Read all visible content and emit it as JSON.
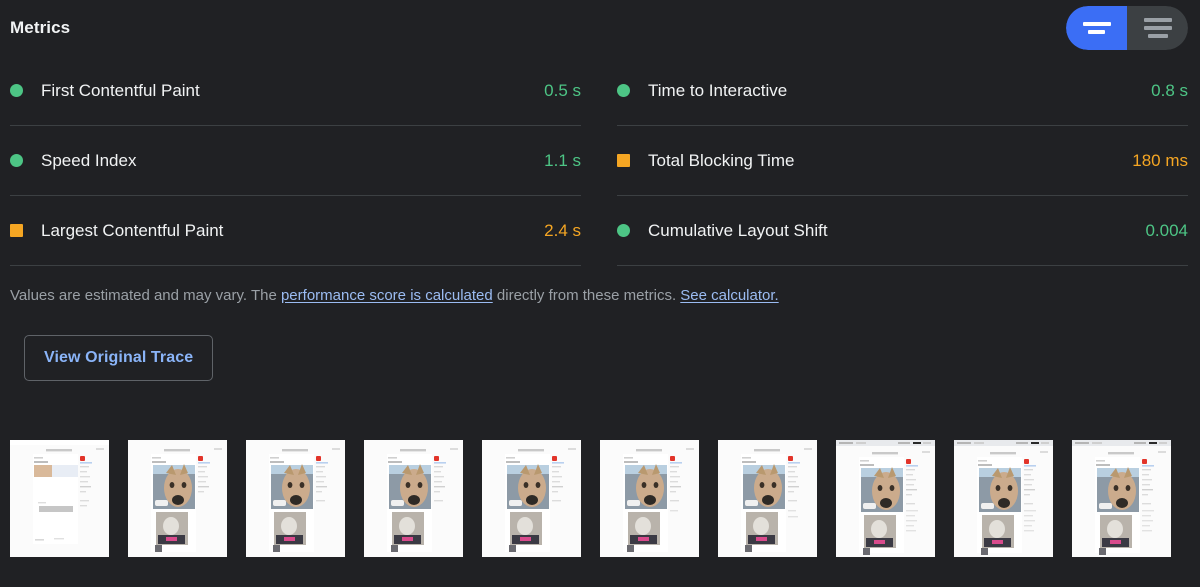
{
  "header": {
    "title": "Metrics",
    "toggle": {
      "left": {
        "name": "simple-view-toggle",
        "active": true,
        "lines": 2
      },
      "right": {
        "name": "expanded-view-toggle",
        "active": false,
        "lines": 3
      }
    }
  },
  "metrics": {
    "left_column": [
      {
        "label": "First Contentful Paint",
        "value": "0.5 s",
        "rating": "pass",
        "indicator": "circle-icon"
      },
      {
        "label": "Speed Index",
        "value": "1.1 s",
        "rating": "pass",
        "indicator": "circle-icon"
      },
      {
        "label": "Largest Contentful Paint",
        "value": "2.4 s",
        "rating": "average",
        "indicator": "square-icon"
      }
    ],
    "right_column": [
      {
        "label": "Time to Interactive",
        "value": "0.8 s",
        "rating": "pass",
        "indicator": "circle-icon"
      },
      {
        "label": "Total Blocking Time",
        "value": "180 ms",
        "rating": "average",
        "indicator": "square-icon"
      },
      {
        "label": "Cumulative Layout Shift",
        "value": "0.004",
        "rating": "pass",
        "indicator": "circle-icon"
      }
    ]
  },
  "disclaimer": {
    "part1": "Values are estimated and may vary. The ",
    "link1": "performance score is calculated",
    "part2": " directly from these metrics. ",
    "link2": "See calculator."
  },
  "trace_button": {
    "label": "View Original Trace"
  },
  "filmstrip": {
    "frames": [
      {
        "index": 1,
        "state": "blank-with-placeholder"
      },
      {
        "index": 2,
        "state": "hero-image-loaded"
      },
      {
        "index": 3,
        "state": "hero-image-loaded"
      },
      {
        "index": 4,
        "state": "hero-image-loaded"
      },
      {
        "index": 5,
        "state": "hero-image-loaded"
      },
      {
        "index": 6,
        "state": "hero-image-loaded"
      },
      {
        "index": 7,
        "state": "hero-image-loaded"
      },
      {
        "index": 8,
        "state": "fully-loaded-with-chrome"
      },
      {
        "index": 9,
        "state": "fully-loaded-with-chrome"
      },
      {
        "index": 10,
        "state": "fully-loaded-with-chrome"
      }
    ]
  },
  "colors": {
    "background": "#202124",
    "pass": "#4dc585",
    "average": "#f5a623",
    "accent_blue": "#3b6ef5",
    "link": "#9bbcf2",
    "button_text": "#8ab4f8",
    "divider": "#3c4043",
    "text_primary": "#f1f3f4",
    "text_secondary": "#9aa0a6"
  }
}
